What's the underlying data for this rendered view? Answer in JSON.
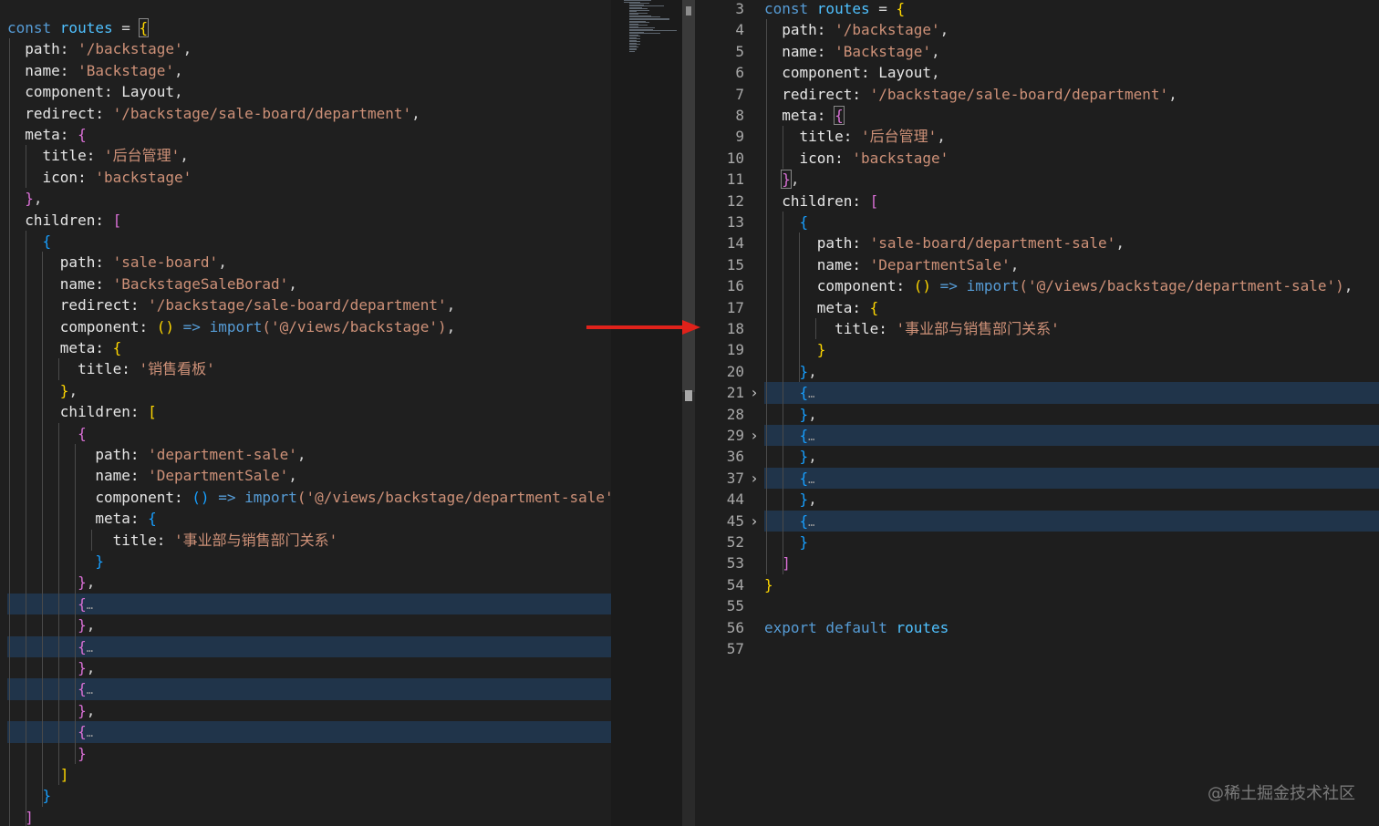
{
  "left_editor": {
    "lines": [
      [
        [
          "const ",
          "kw"
        ],
        [
          "routes",
          "var"
        ],
        [
          " = ",
          "punc"
        ],
        [
          "{",
          "b1"
        ]
      ],
      [
        [
          "  path: ",
          "prop"
        ],
        [
          "'/backstage'",
          "str"
        ],
        [
          ",",
          "punc"
        ]
      ],
      [
        [
          "  name: ",
          "prop"
        ],
        [
          "'Backstage'",
          "str"
        ],
        [
          ",",
          "punc"
        ]
      ],
      [
        [
          "  component: ",
          "prop"
        ],
        [
          "Layout",
          "prop"
        ],
        [
          ",",
          "punc"
        ]
      ],
      [
        [
          "  redirect: ",
          "prop"
        ],
        [
          "'/backstage/sale-board/department'",
          "str"
        ],
        [
          ",",
          "punc"
        ]
      ],
      [
        [
          "  meta: ",
          "prop"
        ],
        [
          "{",
          "b2"
        ]
      ],
      [
        [
          "    title: ",
          "prop"
        ],
        [
          "'后台管理'",
          "str"
        ],
        [
          ",",
          "punc"
        ]
      ],
      [
        [
          "    icon: ",
          "prop"
        ],
        [
          "'backstage'",
          "str"
        ]
      ],
      [
        [
          "  ",
          "punc"
        ],
        [
          "}",
          "b2"
        ],
        [
          ",",
          "punc"
        ]
      ],
      [
        [
          "  children: ",
          "prop"
        ],
        [
          "[",
          "b2"
        ]
      ],
      [
        [
          "    ",
          "punc"
        ],
        [
          "{",
          "b3"
        ]
      ],
      [
        [
          "      path: ",
          "prop"
        ],
        [
          "'sale-board'",
          "str"
        ],
        [
          ",",
          "punc"
        ]
      ],
      [
        [
          "      name: ",
          "prop"
        ],
        [
          "'BackstageSaleBorad'",
          "str"
        ],
        [
          ",",
          "punc"
        ]
      ],
      [
        [
          "      redirect: ",
          "prop"
        ],
        [
          "'/backstage/sale-board/department'",
          "str"
        ],
        [
          ",",
          "punc"
        ]
      ],
      [
        [
          "      component: ",
          "prop"
        ],
        [
          "()",
          "b1"
        ],
        [
          " ",
          "punc"
        ],
        [
          "=>",
          "kw"
        ],
        [
          " ",
          "punc"
        ],
        [
          "import",
          "kw"
        ],
        [
          "('@/views/backstage')",
          "str"
        ],
        [
          ",",
          "punc"
        ]
      ],
      [
        [
          "      meta: ",
          "prop"
        ],
        [
          "{",
          "b1"
        ]
      ],
      [
        [
          "        title: ",
          "prop"
        ],
        [
          "'销售看板'",
          "str"
        ]
      ],
      [
        [
          "      ",
          "punc"
        ],
        [
          "}",
          "b1"
        ],
        [
          ",",
          "punc"
        ]
      ],
      [
        [
          "      children: ",
          "prop"
        ],
        [
          "[",
          "b1"
        ]
      ],
      [
        [
          "        ",
          "punc"
        ],
        [
          "{",
          "b2"
        ]
      ],
      [
        [
          "          path: ",
          "prop"
        ],
        [
          "'department-sale'",
          "str"
        ],
        [
          ",",
          "punc"
        ]
      ],
      [
        [
          "          name: ",
          "prop"
        ],
        [
          "'DepartmentSale'",
          "str"
        ],
        [
          ",",
          "punc"
        ]
      ],
      [
        [
          "          component: ",
          "prop"
        ],
        [
          "()",
          "b3"
        ],
        [
          " ",
          "punc"
        ],
        [
          "=>",
          "kw"
        ],
        [
          " ",
          "punc"
        ],
        [
          "import",
          "kw"
        ],
        [
          "('@/views/backstage/department-sale')",
          "str"
        ],
        [
          ",",
          "punc"
        ]
      ],
      [
        [
          "          meta: ",
          "prop"
        ],
        [
          "{",
          "b3"
        ]
      ],
      [
        [
          "            title: ",
          "prop"
        ],
        [
          "'事业部与销售部门关系'",
          "str"
        ]
      ],
      [
        [
          "          ",
          "punc"
        ],
        [
          "}",
          "b3"
        ]
      ],
      [
        [
          "        ",
          "punc"
        ],
        [
          "}",
          "b2"
        ],
        [
          ",",
          "punc"
        ]
      ],
      [
        [
          "        ",
          "punc"
        ],
        [
          "{",
          "b2"
        ],
        [
          "…",
          "dots"
        ]
      ],
      [
        [
          "        ",
          "punc"
        ],
        [
          "}",
          "b2"
        ],
        [
          ",",
          "punc"
        ]
      ],
      [
        [
          "        ",
          "punc"
        ],
        [
          "{",
          "b2"
        ],
        [
          "…",
          "dots"
        ]
      ],
      [
        [
          "        ",
          "punc"
        ],
        [
          "}",
          "b2"
        ],
        [
          ",",
          "punc"
        ]
      ],
      [
        [
          "        ",
          "punc"
        ],
        [
          "{",
          "b2"
        ],
        [
          "…",
          "dots"
        ]
      ],
      [
        [
          "        ",
          "punc"
        ],
        [
          "}",
          "b2"
        ],
        [
          ",",
          "punc"
        ]
      ],
      [
        [
          "        ",
          "punc"
        ],
        [
          "{",
          "b2"
        ],
        [
          "…",
          "dots"
        ]
      ],
      [
        [
          "        ",
          "punc"
        ],
        [
          "}",
          "b2"
        ]
      ],
      [
        [
          "      ",
          "punc"
        ],
        [
          "]",
          "b1"
        ]
      ],
      [
        [
          "    ",
          "punc"
        ],
        [
          "}",
          "b3"
        ]
      ],
      [
        [
          "  ",
          "punc"
        ],
        [
          "]",
          "b2"
        ]
      ]
    ]
  },
  "right_editor": {
    "line_numbers": [
      "3",
      "4",
      "5",
      "6",
      "7",
      "8",
      "9",
      "10",
      "11",
      "12",
      "13",
      "14",
      "15",
      "16",
      "17",
      "18",
      "19",
      "20",
      "21",
      "28",
      "29",
      "36",
      "37",
      "44",
      "45",
      "52",
      "53",
      "54",
      "55",
      "56",
      "57"
    ],
    "lines": [
      [
        [
          "const ",
          "kw"
        ],
        [
          "routes",
          "var"
        ],
        [
          " = ",
          "punc"
        ],
        [
          "{",
          "b1"
        ]
      ],
      [
        [
          "  path: ",
          "prop"
        ],
        [
          "'/backstage'",
          "str"
        ],
        [
          ",",
          "punc"
        ]
      ],
      [
        [
          "  name: ",
          "prop"
        ],
        [
          "'Backstage'",
          "str"
        ],
        [
          ",",
          "punc"
        ]
      ],
      [
        [
          "  component: ",
          "prop"
        ],
        [
          "Layout",
          "prop"
        ],
        [
          ",",
          "punc"
        ]
      ],
      [
        [
          "  redirect: ",
          "prop"
        ],
        [
          "'/backstage/sale-board/department'",
          "str"
        ],
        [
          ",",
          "punc"
        ]
      ],
      [
        [
          "  meta: ",
          "prop"
        ],
        [
          "{",
          "b2"
        ]
      ],
      [
        [
          "    title: ",
          "prop"
        ],
        [
          "'后台管理'",
          "str"
        ],
        [
          ",",
          "punc"
        ]
      ],
      [
        [
          "    icon: ",
          "prop"
        ],
        [
          "'backstage'",
          "str"
        ]
      ],
      [
        [
          "  ",
          "punc"
        ],
        [
          "}",
          "b2"
        ],
        [
          ",",
          "punc"
        ]
      ],
      [
        [
          "  children: ",
          "prop"
        ],
        [
          "[",
          "b2"
        ]
      ],
      [
        [
          "    ",
          "punc"
        ],
        [
          "{",
          "b3"
        ]
      ],
      [
        [
          "      path: ",
          "prop"
        ],
        [
          "'sale-board/department-sale'",
          "str"
        ],
        [
          ",",
          "punc"
        ]
      ],
      [
        [
          "      name: ",
          "prop"
        ],
        [
          "'DepartmentSale'",
          "str"
        ],
        [
          ",",
          "punc"
        ]
      ],
      [
        [
          "      component: ",
          "prop"
        ],
        [
          "()",
          "b1"
        ],
        [
          " ",
          "punc"
        ],
        [
          "=>",
          "kw"
        ],
        [
          " ",
          "punc"
        ],
        [
          "import",
          "kw"
        ],
        [
          "('@/views/backstage/department-sale')",
          "str"
        ],
        [
          ",",
          "punc"
        ]
      ],
      [
        [
          "      meta: ",
          "prop"
        ],
        [
          "{",
          "b1"
        ]
      ],
      [
        [
          "        title: ",
          "prop"
        ],
        [
          "'事业部与销售部门关系'",
          "str"
        ]
      ],
      [
        [
          "      ",
          "punc"
        ],
        [
          "}",
          "b1"
        ]
      ],
      [
        [
          "    ",
          "punc"
        ],
        [
          "}",
          "b3"
        ],
        [
          ",",
          "punc"
        ]
      ],
      [
        [
          "    ",
          "punc"
        ],
        [
          "{",
          "b3"
        ],
        [
          "…",
          "dots"
        ]
      ],
      [
        [
          "    ",
          "punc"
        ],
        [
          "}",
          "b3"
        ],
        [
          ",",
          "punc"
        ]
      ],
      [
        [
          "    ",
          "punc"
        ],
        [
          "{",
          "b3"
        ],
        [
          "…",
          "dots"
        ]
      ],
      [
        [
          "    ",
          "punc"
        ],
        [
          "}",
          "b3"
        ],
        [
          ",",
          "punc"
        ]
      ],
      [
        [
          "    ",
          "punc"
        ],
        [
          "{",
          "b3"
        ],
        [
          "…",
          "dots"
        ]
      ],
      [
        [
          "    ",
          "punc"
        ],
        [
          "}",
          "b3"
        ],
        [
          ",",
          "punc"
        ]
      ],
      [
        [
          "    ",
          "punc"
        ],
        [
          "{",
          "b3"
        ],
        [
          "…",
          "dots"
        ]
      ],
      [
        [
          "    ",
          "punc"
        ],
        [
          "}",
          "b3"
        ]
      ],
      [
        [
          "  ",
          "punc"
        ],
        [
          "]",
          "b2"
        ]
      ],
      [
        [
          "",
          "punc"
        ],
        [
          "}",
          "b1"
        ]
      ],
      [
        [
          "",
          "punc"
        ]
      ],
      [
        [
          "export default ",
          "kw"
        ],
        [
          "routes",
          "var"
        ]
      ],
      [
        [
          "",
          "punc"
        ]
      ]
    ]
  },
  "watermark": "@稀土掘金技术社区"
}
